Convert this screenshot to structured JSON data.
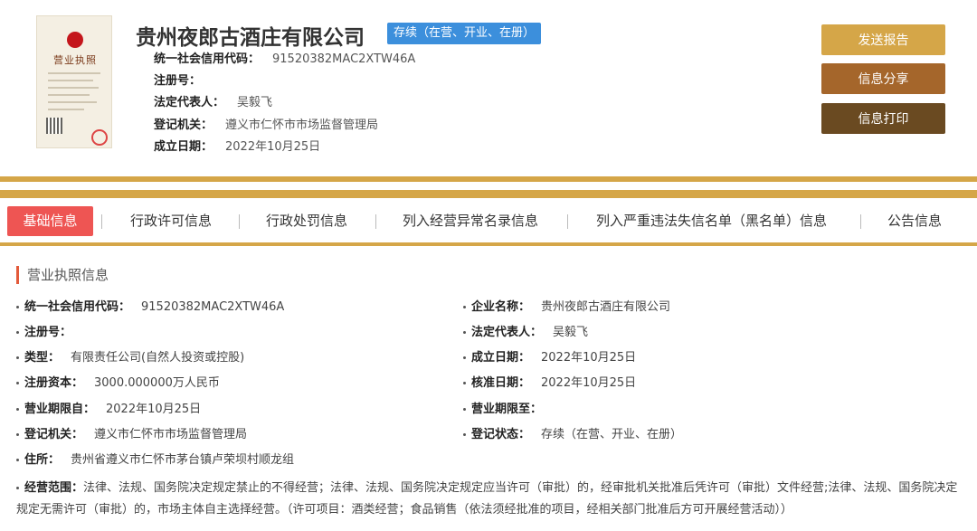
{
  "company": {
    "name": "贵州夜郎古酒庄有限公司",
    "status_badge": "存续（在营、开业、在册）",
    "license_thumb_title": "营业执照"
  },
  "header_meta": [
    {
      "key": "统一社会信用代码：",
      "value": "91520382MAC2XTW46A"
    },
    {
      "key": "注册号：",
      "value": ""
    },
    {
      "key": "法定代表人：",
      "value": "吴毅飞"
    },
    {
      "key": "登记机关：",
      "value": "遵义市仁怀市市场监督管理局"
    },
    {
      "key": "成立日期：",
      "value": "2022年10月25日"
    }
  ],
  "actions": {
    "report": "发送报告",
    "share": "信息分享",
    "print": "信息打印"
  },
  "tabs": [
    {
      "label": "基础信息",
      "active": true
    },
    {
      "label": "行政许可信息",
      "active": false
    },
    {
      "label": "行政处罚信息",
      "active": false
    },
    {
      "label": "列入经营异常名录信息",
      "active": false
    },
    {
      "label": "列入严重违法失信名单（黑名单）信息",
      "active": false
    },
    {
      "label": "公告信息",
      "active": false
    }
  ],
  "section": {
    "title": "营业执照信息"
  },
  "fields_left": [
    {
      "key": "统一社会信用代码：",
      "value": "91520382MAC2XTW46A"
    },
    {
      "key": "注册号：",
      "value": ""
    },
    {
      "key": "类型：",
      "value": "有限责任公司(自然人投资或控股)"
    },
    {
      "key": "注册资本：",
      "value": "3000.000000万人民币"
    },
    {
      "key": "营业期限自：",
      "value": "2022年10月25日"
    },
    {
      "key": "登记机关：",
      "value": "遵义市仁怀市市场监督管理局"
    },
    {
      "key": "住所：",
      "value": "贵州省遵义市仁怀市茅台镇卢荣坝村顺龙组"
    }
  ],
  "fields_right": [
    {
      "key": "企业名称：",
      "value": "贵州夜郎古酒庄有限公司"
    },
    {
      "key": "法定代表人：",
      "value": "吴毅飞"
    },
    {
      "key": "成立日期：",
      "value": "2022年10月25日"
    },
    {
      "key": "核准日期：",
      "value": "2022年10月25日"
    },
    {
      "key": "营业期限至：",
      "value": ""
    },
    {
      "key": "登记状态：",
      "value": "存续（在营、开业、在册）"
    }
  ],
  "scope": {
    "key": "经营范围：",
    "value": "法律、法规、国务院决定规定禁止的不得经营；法律、法规、国务院决定规定应当许可（审批）的，经审批机关批准后凭许可（审批）文件经营;法律、法规、国务院决定规定无需许可（审批）的，市场主体自主选择经营。（许可项目：酒类经营；食品销售（依法须经批准的项目，经相关部门批准后方可开展经营活动））"
  },
  "colors": {
    "gold": "#d5a648",
    "share_brown": "#a5662b",
    "print_dark": "#6a4a21",
    "active_tab": "#ee5553",
    "status_blue": "#3c8fdc"
  }
}
